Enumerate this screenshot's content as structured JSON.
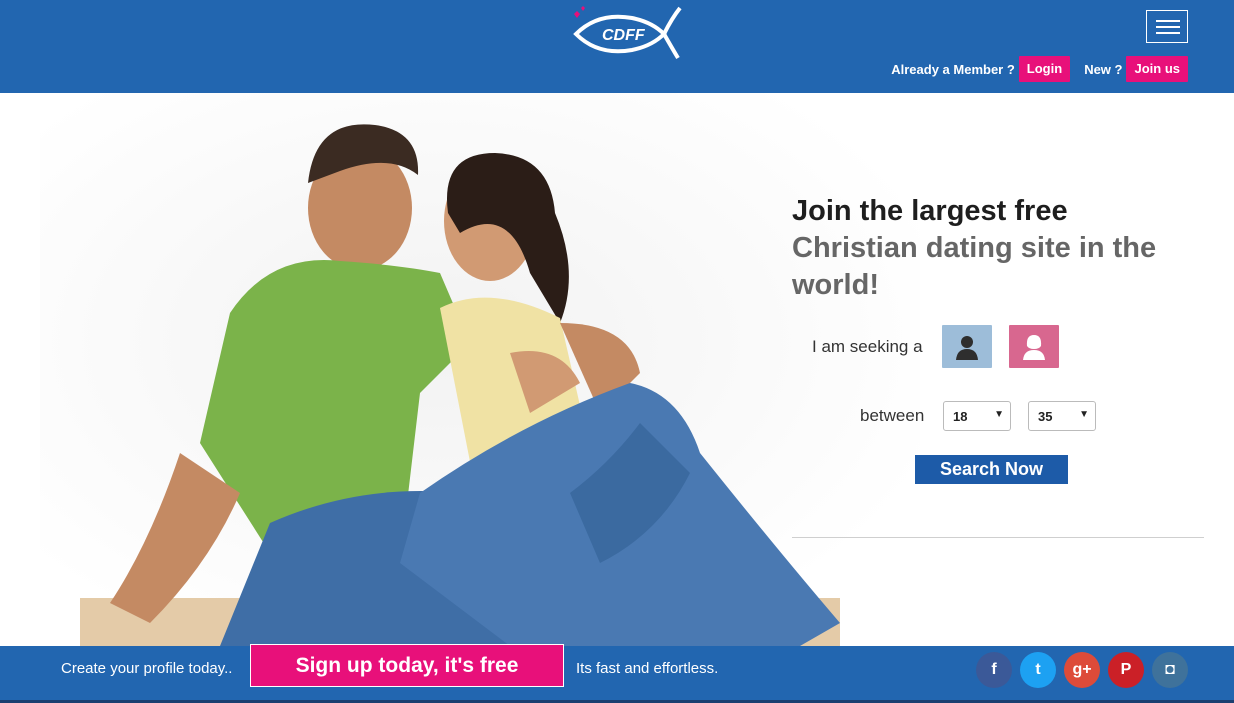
{
  "header": {
    "logo_text": "CDFF",
    "member_prompt": "Already a Member ?",
    "login_label": "Login",
    "new_prompt": "New ?",
    "join_label": "Join us"
  },
  "hero": {
    "headline_line1": "Join the largest free",
    "headline_line2": "Christian dating site in the world!",
    "seeking_label": "I am seeking a",
    "between_label": "between",
    "age_min": "18",
    "age_max": "35",
    "search_label": "Search Now"
  },
  "footer": {
    "left_text": "Create your profile today..",
    "signup_label": "Sign up today, it's free",
    "right_text": "Its fast and effortless.",
    "social": [
      {
        "icon": "facebook-icon",
        "glyph": "f",
        "color": "#3b5998"
      },
      {
        "icon": "twitter-icon",
        "glyph": "t",
        "color": "#1da1f2"
      },
      {
        "icon": "google-plus-icon",
        "glyph": "g+",
        "color": "#dd4b39"
      },
      {
        "icon": "pinterest-icon",
        "glyph": "P",
        "color": "#cb2027"
      },
      {
        "icon": "instagram-icon",
        "glyph": "◘",
        "color": "#3f729b"
      }
    ]
  },
  "colors": {
    "brand_blue": "#2266b0",
    "accent_pink": "#e8107a",
    "search_blue": "#1d5ba8"
  }
}
